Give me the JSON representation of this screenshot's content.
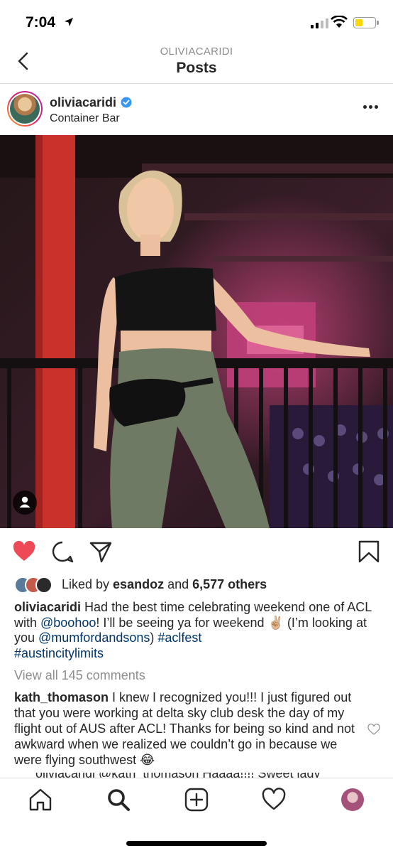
{
  "status_bar": {
    "time": "7:04"
  },
  "header": {
    "username": "OLIVIACARIDI",
    "title": "Posts"
  },
  "post": {
    "username": "oliviacaridi",
    "location": "Container Bar",
    "photo_description": "woman in black crop top and olive cargo pants leaning on railing at night venue",
    "likes": {
      "prefix": "Liked by ",
      "user": "esandoz",
      "middle": " and ",
      "count": "6,577 others"
    },
    "caption": {
      "username": "oliviacaridi",
      "text1": " Had the best time celebrating weekend one of ACL with ",
      "mention1": "@boohoo",
      "text2": "! I’ll be seeing ya for weekend ✌🏼 (I’m looking at you ",
      "mention2": "@mumfordandsons",
      "text3": ") ",
      "tag1": "#aclfest",
      "tag2": "#austincitylimits"
    },
    "view_all": "View all 145 comments",
    "comment": {
      "username": "kath_thomason",
      "text": " I knew I recognized you!!! I just figured out that you were working at delta sky club desk the day of my flight out of AUS after ACL! Thanks for being so kind and not awkward when we realized we couldn’t go in because we were flying southwest 😂"
    },
    "reply_partial": "oliviacaridi @kath_thomason Haaaa!!!! Sweet lady"
  },
  "colors": {
    "like_red": "#ed4956",
    "link": "#003569",
    "verified_blue": "#3897f0"
  },
  "icons": [
    "back-icon",
    "verified-icon",
    "more-icon",
    "heart-icon",
    "comment-icon",
    "share-icon",
    "bookmark-icon",
    "home-icon",
    "search-icon",
    "add-icon",
    "activity-icon"
  ]
}
